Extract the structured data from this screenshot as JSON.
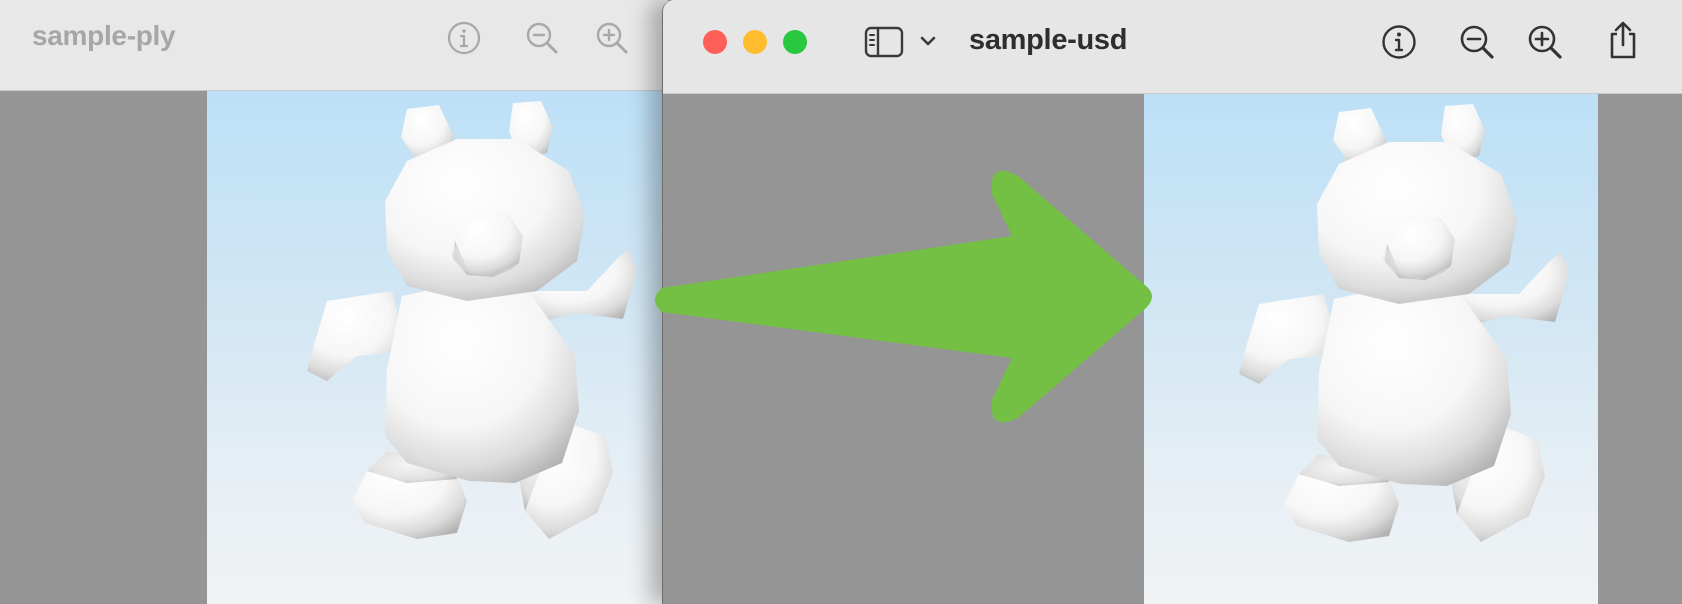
{
  "windows": [
    {
      "title": "sample-ply",
      "active": false,
      "toolbar_icons": [
        "info-icon",
        "zoom-out-icon",
        "zoom-in-icon"
      ]
    },
    {
      "title": "sample-usd",
      "active": true,
      "toolbar_icons": [
        "sidebar-icon",
        "chevron-down-icon",
        "info-icon",
        "zoom-out-icon",
        "zoom-in-icon",
        "share-icon"
      ]
    }
  ],
  "colors": {
    "traffic_close": "#fe5f57",
    "traffic_minimize": "#febc2e",
    "traffic_zoom": "#28c840",
    "arrow": "#74c044",
    "canvas_gray": "#959595",
    "toolbar_bg": "#e8e8e8"
  },
  "annotation": {
    "shape": "arrow",
    "direction": "right",
    "color": "#74c044"
  }
}
